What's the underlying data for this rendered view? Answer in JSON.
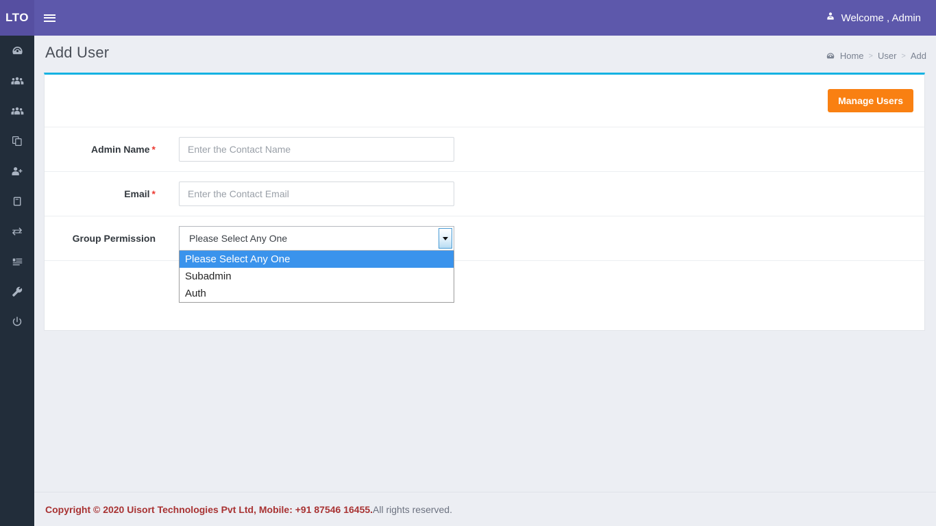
{
  "brand": {
    "logo_text": "LTO"
  },
  "topbar": {
    "menu_icon": "hamburger-icon",
    "welcome_icon": "user-admin-icon",
    "welcome_text": "Welcome , Admin"
  },
  "sidebar": {
    "items": [
      {
        "icon": "dashboard-speedometer-icon",
        "name": "dashboard"
      },
      {
        "icon": "users-group-icon",
        "name": "users"
      },
      {
        "icon": "users-group-icon",
        "name": "groups"
      },
      {
        "icon": "copy-layers-icon",
        "name": "copy"
      },
      {
        "icon": "user-add-icon",
        "name": "add-user"
      },
      {
        "icon": "book-icon",
        "name": "book"
      },
      {
        "icon": "exchange-arrows-icon",
        "name": "transfer"
      },
      {
        "icon": "list-server-icon",
        "name": "reports"
      },
      {
        "icon": "wrench-icon",
        "name": "settings"
      },
      {
        "icon": "power-icon",
        "name": "logout"
      }
    ]
  },
  "page": {
    "title": "Add User",
    "breadcrumb": {
      "home_icon": "dashboard-icon",
      "items": [
        "Home",
        "User",
        "Add"
      ],
      "separator": ">"
    }
  },
  "card": {
    "manage_users_label": "Manage Users",
    "fields": {
      "admin_name": {
        "label": "Admin Name",
        "required_mark": "*",
        "value": "",
        "placeholder": "Enter the Contact Name"
      },
      "email": {
        "label": "Email",
        "required_mark": "*",
        "value": "",
        "placeholder": "Enter the Contact Email"
      },
      "group_permission": {
        "label": "Group Permission",
        "selected": "Please Select Any One",
        "options": [
          "Please Select Any One",
          "Subadmin",
          "Auth"
        ],
        "expanded": true
      }
    },
    "actions": [
      {
        "label": "",
        "name": "submit-button"
      },
      {
        "label": "",
        "name": "reset-button"
      }
    ]
  },
  "footer": {
    "copyright_strong": "Copyright © 2020 Uisort Technologies Pvt Ltd, Mobile: +91 87546 16455.",
    "copyright_rest": " All rights reserved."
  },
  "colors": {
    "sidebar": "#222d3a",
    "topbar": "#5d58ab",
    "brand": "#564fa1",
    "accent_cyan": "#14b2e2",
    "orange": "#f98012",
    "red": "#e04b38",
    "dropdown_highlight": "#3a93ec",
    "footer_text": "#a83232"
  }
}
